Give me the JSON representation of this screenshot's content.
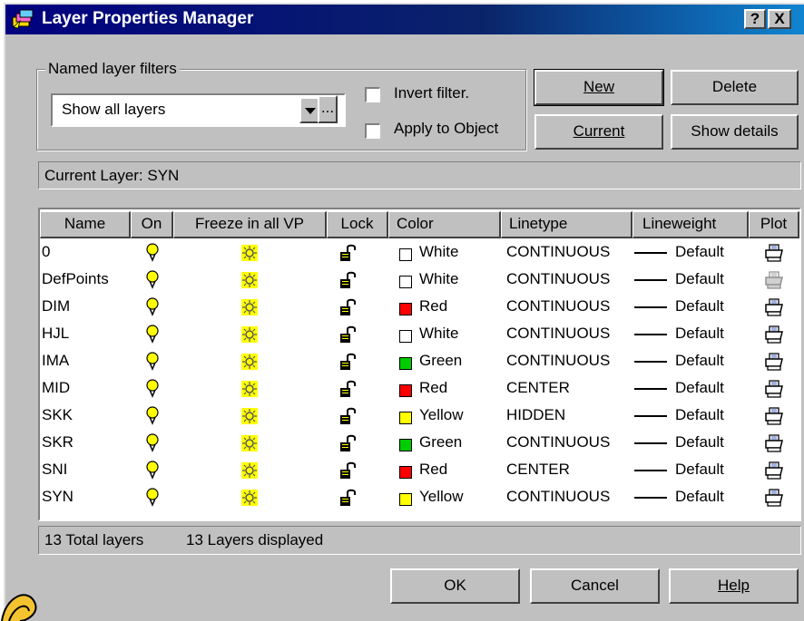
{
  "window": {
    "title": "Layer Properties Manager",
    "help_button": "?",
    "close_button": "X"
  },
  "filters": {
    "group_label": "Named layer filters",
    "selected": "Show all layers",
    "more_button": "...",
    "invert_label": "Invert filter.",
    "apply_label": "Apply to Object"
  },
  "buttons": {
    "new": "New",
    "delete": "Delete",
    "current": "Current",
    "show_details": "Show details",
    "ok": "OK",
    "cancel": "Cancel",
    "help": "Help"
  },
  "current_layer": "Current Layer:  SYN",
  "columns": [
    "Name",
    "On",
    "Freeze in all VP",
    "Lock",
    "Color",
    "Linetype",
    "Lineweight",
    "Plot"
  ],
  "layers": [
    {
      "name": "0",
      "color": "White",
      "color_hex": "#ffffff",
      "linetype": "CONTINUOUS",
      "lineweight": "Default",
      "plot": "plot-enabled"
    },
    {
      "name": "DefPoints",
      "color": "White",
      "color_hex": "#ffffff",
      "linetype": "CONTINUOUS",
      "lineweight": "Default",
      "plot": "plot-disabled"
    },
    {
      "name": "DIM",
      "color": "Red",
      "color_hex": "#ff0000",
      "linetype": "CONTINUOUS",
      "lineweight": "Default",
      "plot": "plot-enabled"
    },
    {
      "name": "HJL",
      "color": "White",
      "color_hex": "#ffffff",
      "linetype": "CONTINUOUS",
      "lineweight": "Default",
      "plot": "plot-enabled"
    },
    {
      "name": "IMA",
      "color": "Green",
      "color_hex": "#00cc00",
      "linetype": "CONTINUOUS",
      "lineweight": "Default",
      "plot": "plot-enabled"
    },
    {
      "name": "MID",
      "color": "Red",
      "color_hex": "#ff0000",
      "linetype": "CENTER",
      "lineweight": "Default",
      "plot": "plot-enabled"
    },
    {
      "name": "SKK",
      "color": "Yellow",
      "color_hex": "#ffff00",
      "linetype": "HIDDEN",
      "lineweight": "Default",
      "plot": "plot-enabled"
    },
    {
      "name": "SKR",
      "color": "Green",
      "color_hex": "#00cc00",
      "linetype": "CONTINUOUS",
      "lineweight": "Default",
      "plot": "plot-enabled"
    },
    {
      "name": "SNI",
      "color": "Red",
      "color_hex": "#ff0000",
      "linetype": "CENTER",
      "lineweight": "Default",
      "plot": "plot-enabled"
    },
    {
      "name": "SYN",
      "color": "Yellow",
      "color_hex": "#ffff00",
      "linetype": "CONTINUOUS",
      "lineweight": "Default",
      "plot": "plot-enabled"
    }
  ],
  "status": {
    "total": "13 Total layers",
    "displayed": "13 Layers displayed"
  },
  "icons": {
    "on": "lightbulb-icon",
    "freeze": "sun-icon",
    "lock": "unlocked-padlock-icon",
    "plot": "printer-icon"
  },
  "theme": {
    "title_bar": "#000080",
    "face": "#c0c0c0",
    "bulb": "#ffff00",
    "sun": "#ffff00"
  }
}
